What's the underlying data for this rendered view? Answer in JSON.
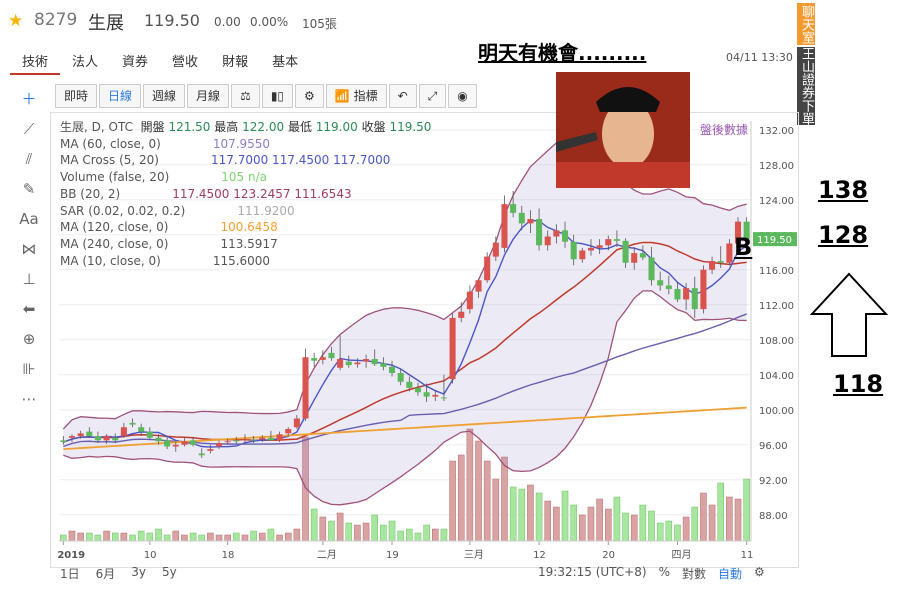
{
  "header": {
    "star_icon": "star-icon",
    "code": "8279",
    "name": "生展",
    "price": "119.50",
    "change": "0.00",
    "change_pct": "0.00%",
    "volume": "105張"
  },
  "tabs": [
    "技術",
    "法人",
    "資券",
    "營收",
    "財報",
    "基本"
  ],
  "headline": "明天有機會.........",
  "datetime": "04/11 13:30",
  "side_banner": {
    "top": "聊天室",
    "bottom": "王山證券下單"
  },
  "toolbar": {
    "buttons": [
      "即時",
      "日線",
      "週線",
      "月線",
      "指標"
    ],
    "selected": "日線"
  },
  "legend": {
    "main": {
      "label": "生展, D, OTC",
      "open_label": "開盤",
      "open": "121.50",
      "high_label": "最高",
      "high": "122.00",
      "low_label": "最低",
      "low": "119.00",
      "close_label": "收盤",
      "close": "119.50"
    },
    "indicators": [
      {
        "label": "MA (60, close, 0)",
        "value": "107.9550",
        "color": "#8a7fc8"
      },
      {
        "label": "MA Cross (5, 20)",
        "value": "117.7000  117.4500  117.7000",
        "color": "#4b55c8"
      },
      {
        "label": "Volume (false, 20)",
        "value": "105  n/a",
        "color": "#7bd36f"
      },
      {
        "label": "BB (20, 2)",
        "value": "117.4500  123.2457  111.6543",
        "color": "#a03c60"
      },
      {
        "label": "SAR (0.02, 0.02, 0.2)",
        "value": "111.9200",
        "color": "#aaa"
      },
      {
        "label": "MA (120, close, 0)",
        "value": "100.6458",
        "color": "#f0a030"
      },
      {
        "label": "MA (240, close, 0)",
        "value": "113.5917",
        "color": "#555"
      },
      {
        "label": "MA (10, close, 0)",
        "value": "115.6000",
        "color": "#555"
      }
    ],
    "after_hours": "盤後數據"
  },
  "annotations": {
    "b": "B",
    "t138": "138",
    "t128": "128",
    "t118": "118"
  },
  "bottom": {
    "ranges": [
      "1日",
      "6月",
      "3y",
      "5y"
    ],
    "time": "19:32:15 (UTC+8)",
    "pct": "%",
    "log": "對數",
    "auto": "自動"
  },
  "chart_data": {
    "type": "candlestick",
    "x_ticks": [
      "2019",
      "10",
      "18",
      "二月",
      "19",
      "三月",
      "12",
      "20",
      "四月",
      "11"
    ],
    "y_ticks": [
      88,
      92,
      96,
      100,
      104,
      108,
      112,
      116,
      120,
      124,
      128,
      132
    ],
    "ylim": [
      85,
      133
    ],
    "last_price_label": "119.50",
    "candles": [
      [
        96.5,
        97,
        96,
        96.3
      ],
      [
        96.8,
        97.2,
        96.3,
        97
      ],
      [
        97,
        97.6,
        96.7,
        97.3
      ],
      [
        97.5,
        98,
        96.8,
        97
      ],
      [
        97,
        97.5,
        96.2,
        96.5
      ],
      [
        96.5,
        97.2,
        96.1,
        97
      ],
      [
        96.8,
        97.3,
        96.2,
        96.5
      ],
      [
        97,
        98.5,
        96.8,
        98
      ],
      [
        98.5,
        99,
        98,
        98.3
      ],
      [
        98,
        98.4,
        97,
        97.5
      ],
      [
        97.5,
        98,
        96.5,
        96.8
      ],
      [
        96.8,
        97.2,
        96,
        96.4
      ],
      [
        96.5,
        97,
        95.5,
        95.8
      ],
      [
        95.8,
        96.3,
        95.2,
        96
      ],
      [
        96,
        96.8,
        95.8,
        96.4
      ],
      [
        96.5,
        96.9,
        95.8,
        96
      ],
      [
        95,
        95.6,
        94.5,
        94.8
      ],
      [
        95.3,
        96,
        95,
        95.5
      ],
      [
        95.8,
        96.5,
        95.5,
        96.2
      ],
      [
        96.3,
        96.7,
        96,
        96.4
      ],
      [
        96.5,
        96.9,
        96.1,
        96.4
      ],
      [
        96.5,
        97.2,
        96.2,
        96.6
      ],
      [
        96.6,
        97,
        96.2,
        96.5
      ],
      [
        96.6,
        97.1,
        96.3,
        96.8
      ],
      [
        96.8,
        97.6,
        96.5,
        96.5
      ],
      [
        96.5,
        97.5,
        96.3,
        97.2
      ],
      [
        97.3,
        98,
        97,
        97.8
      ],
      [
        98,
        99.4,
        97.8,
        99
      ],
      [
        99,
        107,
        98.7,
        106
      ],
      [
        105.9,
        106.5,
        104.9,
        105.6
      ],
      [
        105.7,
        106.8,
        105.2,
        106
      ],
      [
        106.5,
        107.2,
        105.6,
        105.9
      ],
      [
        104.8,
        108.5,
        104.5,
        105.8
      ],
      [
        105.5,
        106.2,
        104.8,
        105.1
      ],
      [
        105.2,
        105.9,
        104.8,
        105.4
      ],
      [
        105.5,
        106.3,
        104.8,
        105.8
      ],
      [
        105.8,
        106.9,
        105,
        105.2
      ],
      [
        105.3,
        106,
        104.5,
        104.9
      ],
      [
        104.9,
        105.6,
        103.8,
        104.2
      ],
      [
        104.2,
        104.7,
        102.8,
        103.2
      ],
      [
        103.2,
        103.8,
        102.1,
        102.5
      ],
      [
        102.5,
        103.1,
        101.6,
        102
      ],
      [
        102,
        103,
        100.9,
        101.5
      ],
      [
        101.5,
        102.2,
        101,
        101.7
      ],
      [
        101.4,
        104,
        101,
        101.3
      ],
      [
        103.5,
        111,
        103,
        110.5
      ],
      [
        110.5,
        112.3,
        110,
        111.2
      ],
      [
        111.5,
        114.2,
        111,
        113.5
      ],
      [
        113.5,
        115,
        112.8,
        114.8
      ],
      [
        114.8,
        118,
        114.5,
        117.5
      ],
      [
        117.5,
        119.8,
        117,
        119.1
      ],
      [
        118.5,
        124.5,
        118,
        123.5
      ],
      [
        123.5,
        125,
        122,
        122.5
      ],
      [
        122.5,
        123.3,
        120.5,
        121.3
      ],
      [
        121.3,
        122.8,
        120.2,
        121.8
      ],
      [
        121.8,
        123,
        118.2,
        118.8
      ],
      [
        118.8,
        120.5,
        118.2,
        119.8
      ],
      [
        119.8,
        121.2,
        119,
        120.5
      ],
      [
        120.5,
        121.5,
        118.5,
        119.2
      ],
      [
        119.2,
        120,
        116.5,
        117.2
      ],
      [
        117.2,
        118.5,
        116.8,
        118.2
      ],
      [
        118.2,
        119.5,
        117.6,
        118.5
      ],
      [
        118.5,
        119.5,
        117.8,
        118.8
      ],
      [
        118.8,
        119.9,
        118.2,
        119.5
      ],
      [
        119.5,
        120.5,
        118.6,
        119.3
      ],
      [
        119.3,
        119.6,
        116.2,
        116.8
      ],
      [
        116.8,
        118.6,
        116,
        117.9
      ],
      [
        117.9,
        118.8,
        117.1,
        117.4
      ],
      [
        117.4,
        118.6,
        114.2,
        114.8
      ],
      [
        114.8,
        115.8,
        113.6,
        114.2
      ],
      [
        114.2,
        115.3,
        113.2,
        113.8
      ],
      [
        113.8,
        114.6,
        112.3,
        112.6
      ],
      [
        112.6,
        114.5,
        111.4,
        113.9
      ],
      [
        113.9,
        115.2,
        110.5,
        111.5
      ],
      [
        111.5,
        116.5,
        111,
        116
      ],
      [
        116,
        117.5,
        115.5,
        117
      ],
      [
        117,
        118.7,
        116.2,
        116.8
      ],
      [
        116.8,
        119.5,
        116.5,
        119
      ],
      [
        119,
        122,
        119,
        121.5
      ],
      [
        121.5,
        122,
        119,
        119.5
      ]
    ],
    "volume": [
      3,
      5,
      4,
      4,
      3,
      5,
      4,
      4,
      3,
      5,
      4,
      6,
      3,
      5,
      3,
      4,
      3,
      4,
      3,
      3,
      4,
      3,
      5,
      4,
      6,
      3,
      4,
      6,
      52,
      16,
      12,
      10,
      14,
      9,
      8,
      9,
      13,
      8,
      10,
      5,
      6,
      4,
      8,
      6,
      6,
      40,
      43,
      56,
      50,
      40,
      31,
      42,
      27,
      26,
      28,
      24,
      20,
      17,
      25,
      18,
      13,
      17,
      21,
      16,
      22,
      14,
      13,
      18,
      15,
      9,
      10,
      8,
      12,
      17,
      24,
      18,
      29,
      22,
      21,
      31
    ],
    "volume_ylim": [
      0,
      80
    ],
    "series": [
      {
        "name": "MA (60, close, 0)",
        "values_from": "candles",
        "window": 60,
        "color": "#8a7fc8"
      },
      {
        "name": "MA Cross (5, 20)",
        "window": 5,
        "color": "#4b55c8"
      },
      {
        "name": "MA (120, close, 0)",
        "window": 120,
        "color": "#f0a030"
      },
      {
        "name": "BB (20, 2)",
        "window": 20,
        "color": "#a03c60"
      }
    ],
    "grid": true,
    "legend_position": "top-left"
  }
}
